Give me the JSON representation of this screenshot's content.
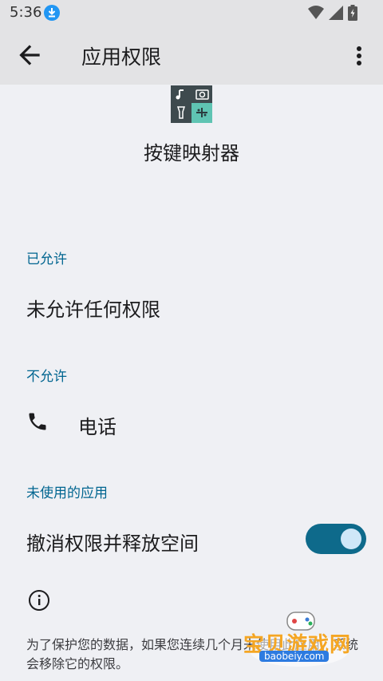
{
  "status_bar": {
    "time": "5:36",
    "download_icon": "download-notification-icon",
    "wifi_icon": "wifi-icon",
    "signal_icon": "cell-signal-icon",
    "battery_icon": "battery-charging-icon"
  },
  "app_bar": {
    "title": "应用权限",
    "back_icon": "arrow-back-icon",
    "more_icon": "more-vert-icon"
  },
  "app": {
    "name": "按键映射器",
    "icon": "app-icon"
  },
  "sections": {
    "allowed": {
      "header": "已允许",
      "item": "未允许任何权限"
    },
    "denied": {
      "header": "不允许",
      "item": "电话",
      "item_icon": "phone-icon"
    },
    "unused": {
      "header": "未使用的应用",
      "toggle_label": "撤消权限并释放空间",
      "toggle_on": true
    }
  },
  "info": {
    "icon": "info-icon",
    "text": "为了保护您的数据，如果您连续几个月未使用此应用，系统会移除它的权限。"
  },
  "watermark": {
    "text": "宝贝游戏网",
    "url": "baobeiy.com"
  },
  "colors": {
    "accent": "#006590",
    "toggle_track": "#0e6a8b",
    "toggle_knob": "#cfe7f8",
    "background": "#eff0f4",
    "appbar": "#e3e3e5"
  }
}
